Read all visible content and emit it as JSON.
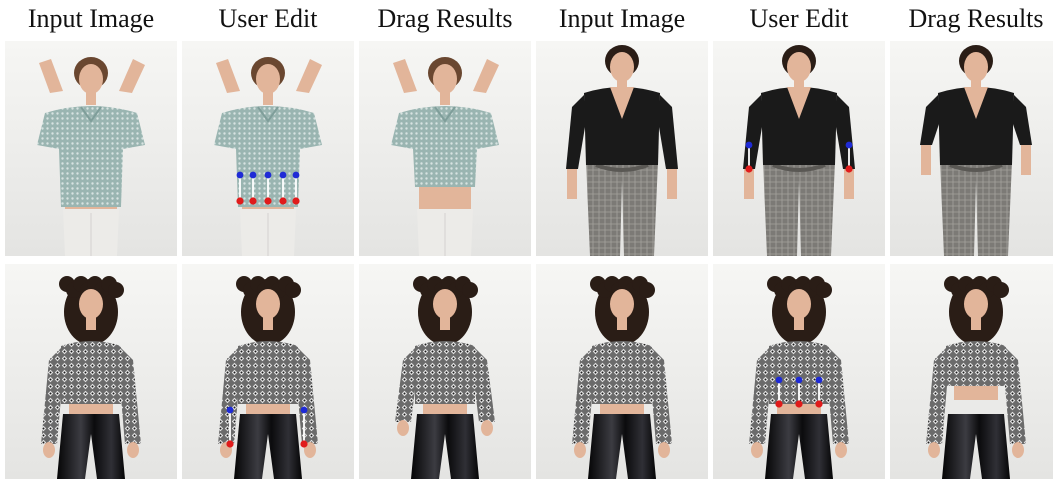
{
  "headers": [
    "Input Image",
    "User Edit",
    "Drag Results",
    "Input Image",
    "User Edit",
    "Drag Results"
  ],
  "colors": {
    "knit_top": "#9ab5b1",
    "white_jeans": "#ecebe8",
    "black_blouse": "#1a1a1a",
    "plaid_pants": "#7c7a76",
    "print_top": "#6b6b6b",
    "leather_pants": "#0e0e10",
    "skin": "#e2b59a",
    "hair_light": "#6a4730",
    "hair_dark": "#2a1d16",
    "handle_target": "#1f2bd6",
    "handle_source": "#e01b1b",
    "drag_arrow": "#ffffff"
  },
  "panels": [
    {
      "row": 0,
      "col": 0,
      "subject": "knit-crop-top",
      "variant": "input",
      "handles": 0
    },
    {
      "row": 0,
      "col": 1,
      "subject": "knit-crop-top",
      "variant": "edit",
      "handles": 5
    },
    {
      "row": 0,
      "col": 2,
      "subject": "knit-crop-top",
      "variant": "result",
      "handles": 0
    },
    {
      "row": 0,
      "col": 3,
      "subject": "black-blouse",
      "variant": "input",
      "handles": 0
    },
    {
      "row": 0,
      "col": 4,
      "subject": "black-blouse",
      "variant": "edit",
      "handles": 2
    },
    {
      "row": 0,
      "col": 5,
      "subject": "black-blouse",
      "variant": "result",
      "handles": 0
    },
    {
      "row": 1,
      "col": 0,
      "subject": "print-top-sleeves",
      "variant": "input",
      "handles": 0
    },
    {
      "row": 1,
      "col": 1,
      "subject": "print-top-sleeves",
      "variant": "edit",
      "handles": 2
    },
    {
      "row": 1,
      "col": 2,
      "subject": "print-top-sleeves",
      "variant": "result",
      "handles": 0
    },
    {
      "row": 1,
      "col": 3,
      "subject": "print-top-hem",
      "variant": "input",
      "handles": 0
    },
    {
      "row": 1,
      "col": 4,
      "subject": "print-top-hem",
      "variant": "edit",
      "handles": 3
    },
    {
      "row": 1,
      "col": 5,
      "subject": "print-top-hem",
      "variant": "result",
      "handles": 0
    }
  ]
}
